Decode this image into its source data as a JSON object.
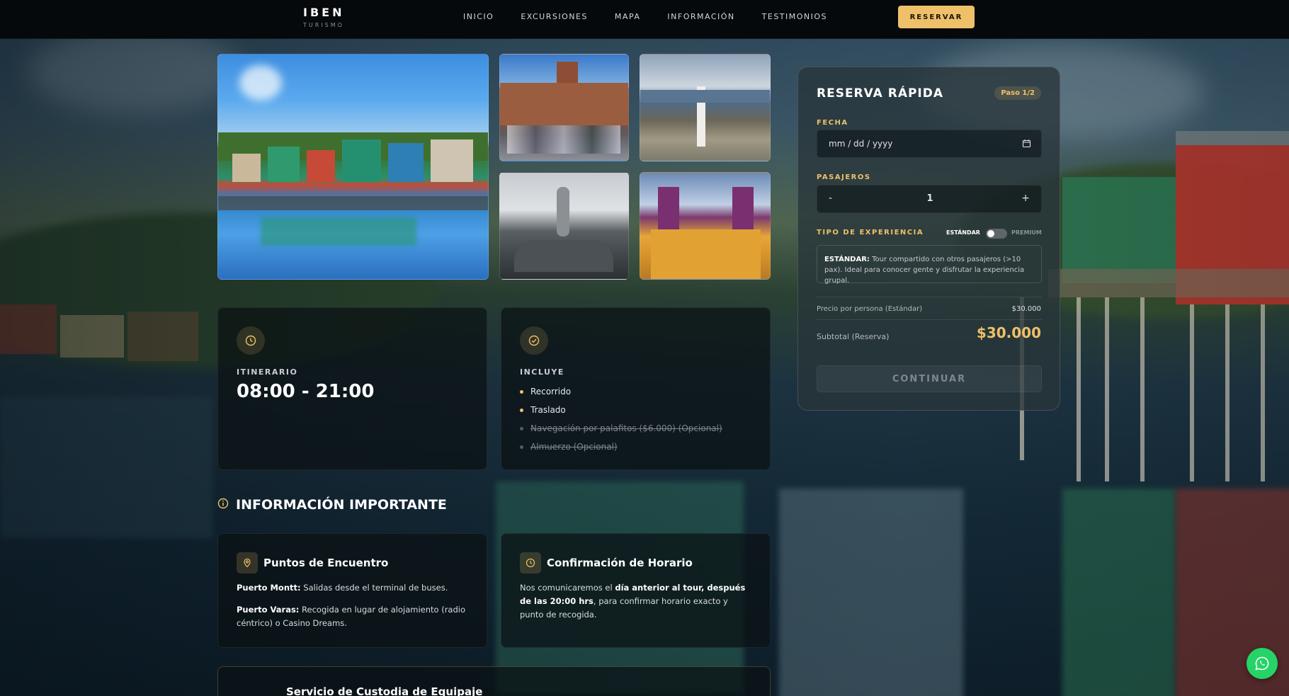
{
  "header": {
    "brand_name": "IBEN",
    "brand_sub": "TURISMO",
    "nav": [
      "INICIO",
      "EXCURSIONES",
      "MAPA",
      "INFORMACIÓN",
      "TESTIMONIOS"
    ],
    "cta_label": "RESERVAR",
    "accent_color": "#eec06a"
  },
  "itinerary": {
    "icon": "clock-icon",
    "label": "ITINERARIO",
    "time": "08:00 - 21:00"
  },
  "includes": {
    "icon": "check-circle-icon",
    "label": "INCLUYE",
    "items": [
      {
        "text": "Recorrido",
        "included": true
      },
      {
        "text": "Traslado",
        "included": true
      },
      {
        "text": "Navegación por palafitos ($6.000) (Opcional)",
        "included": false
      },
      {
        "text": "Almuerzo (Opcional)",
        "included": false
      }
    ]
  },
  "important_info": {
    "icon": "info-icon",
    "title": "INFORMACIÓN IMPORTANTE",
    "meeting": {
      "icon": "map-pin-icon",
      "title": "Puntos de Encuentro",
      "line1_bold": "Puerto Montt:",
      "line1_text": " Salidas desde el terminal de buses.",
      "line2_bold": "Puerto Varas:",
      "line2_text": " Recogida en lugar de alojamiento (radio céntrico) o Casino Dreams."
    },
    "confirmation": {
      "icon": "clock-icon",
      "title": "Confirmación de Horario",
      "text_a": "Nos comunicaremos el ",
      "text_bold": "día anterior al tour, después de las 20:00 hrs",
      "text_b": ", para confirmar horario exacto y punto de recogida."
    },
    "luggage_title": "Servicio de Custodia de Equipaje"
  },
  "booking": {
    "title": "RESERVA RÁPIDA",
    "step": "Paso 1/2",
    "date_label": "FECHA",
    "date_placeholder": "mm / dd / yyyy",
    "passengers_label": "PASAJEROS",
    "passengers_value": "1",
    "minus": "-",
    "plus": "+",
    "experience_label": "TIPO DE EXPERIENCIA",
    "toggle_left": "ESTÁNDAR",
    "toggle_right": "PREMIUM",
    "experience_bold": "ESTÁNDAR:",
    "experience_text": " Tour compartido con otros pasajeros (>10 pax). Ideal para conocer gente y disfrutar la experiencia grupal.",
    "price_label": "Precio por persona (Estándar)",
    "price_value": "$30.000",
    "subtotal_label": "Subtotal (Reserva)",
    "subtotal_value": "$30.000",
    "continue_label": "CONTINUAR"
  },
  "whatsapp_icon": "whatsapp-icon"
}
